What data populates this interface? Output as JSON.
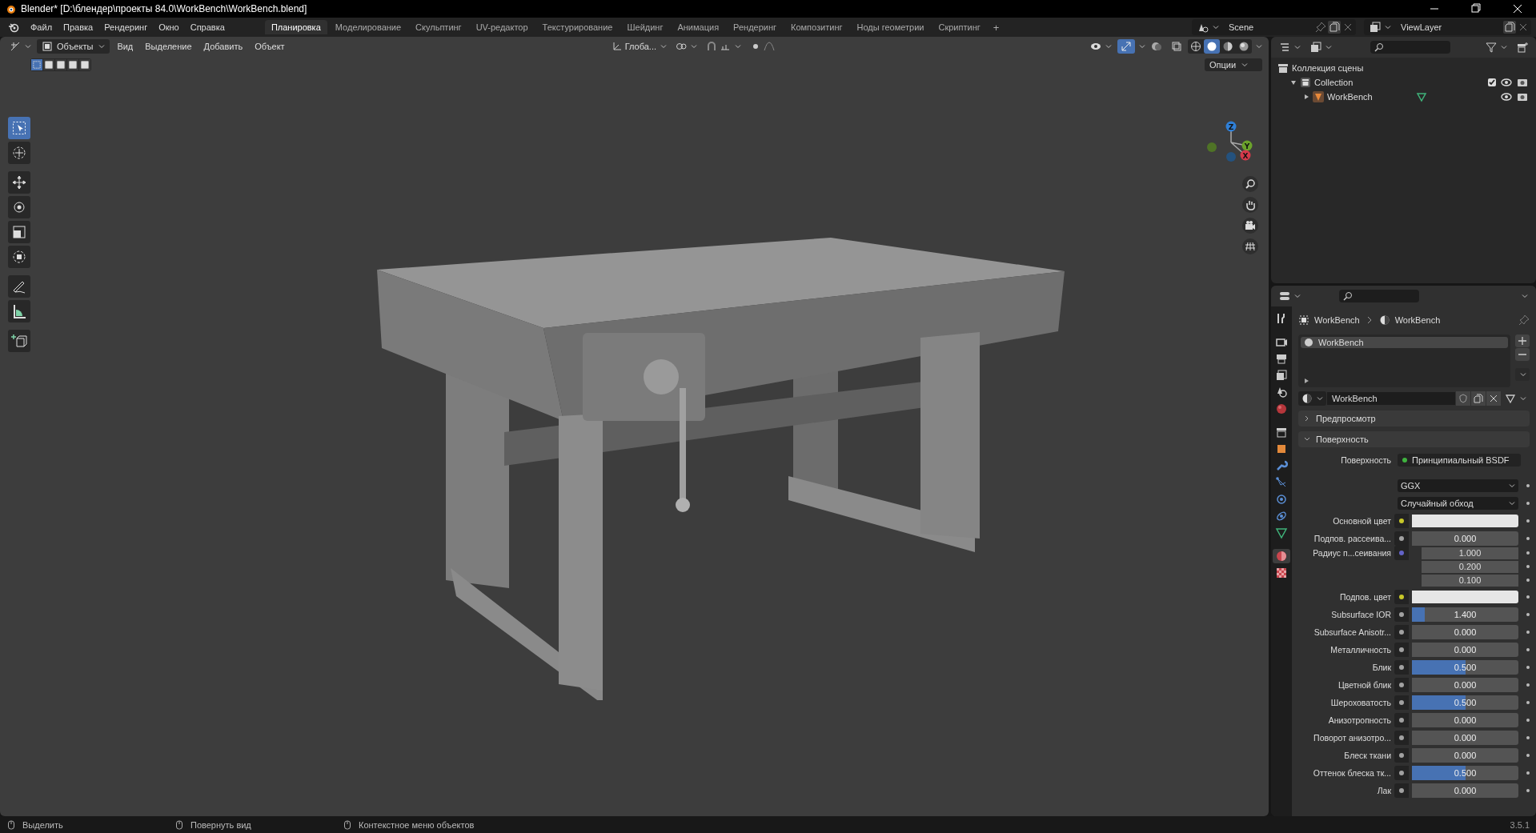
{
  "window": {
    "title": "Blender* [D:\\блендер\\проекты 84.0\\WorkBench\\WorkBench.blend]"
  },
  "menu": [
    "Файл",
    "Правка",
    "Рендеринг",
    "Окно",
    "Справка"
  ],
  "workspaces": [
    {
      "label": "Планировка",
      "selected": true
    },
    {
      "label": "Моделирование",
      "selected": false
    },
    {
      "label": "Скульптинг",
      "selected": false
    },
    {
      "label": "UV-редактор",
      "selected": false
    },
    {
      "label": "Текстурирование",
      "selected": false
    },
    {
      "label": "Шейдинг",
      "selected": false
    },
    {
      "label": "Анимация",
      "selected": false
    },
    {
      "label": "Рендеринг",
      "selected": false
    },
    {
      "label": "Композитинг",
      "selected": false
    },
    {
      "label": "Ноды геометрии",
      "selected": false
    },
    {
      "label": "Скриптинг",
      "selected": false
    }
  ],
  "add_workspace": "+",
  "scene": "Scene",
  "view_layer": "ViewLayer",
  "viewport": {
    "mode": "Объекты",
    "menus": [
      "Вид",
      "Выделение",
      "Добавить",
      "Объект"
    ],
    "orientation": "Глоба...",
    "options": "Опции",
    "select_modes": [
      {
        "selected": true
      },
      {
        "selected": false
      },
      {
        "selected": false
      },
      {
        "selected": false
      },
      {
        "selected": false
      }
    ],
    "gizmos_on": true,
    "shading_modes": [
      {
        "kind": "wireframe",
        "selected": false
      },
      {
        "kind": "solid",
        "selected": true
      },
      {
        "kind": "material",
        "selected": false
      },
      {
        "kind": "rendered",
        "selected": false
      }
    ],
    "tools": [
      {
        "kind": "select",
        "selected": true
      },
      {
        "kind": "cursor",
        "selected": false
      },
      {
        "kind": "move",
        "selected": false
      },
      {
        "kind": "rotate",
        "selected": false
      },
      {
        "kind": "scale",
        "selected": false
      },
      {
        "kind": "transform",
        "selected": false
      },
      {
        "kind": "annotate",
        "selected": false
      },
      {
        "kind": "measure",
        "selected": false
      },
      {
        "kind": "add_cube",
        "selected": false
      }
    ],
    "gizmo_axes": [
      "Z",
      "Y",
      "X"
    ],
    "scene_content": {
      "kind": "picture"
    }
  },
  "outliner": {
    "tree": [
      {
        "label": "Коллекция сцены",
        "kind": "scene_collection",
        "children": [
          {
            "label": "Collection",
            "kind": "collection",
            "expanded": true,
            "checked": true,
            "children": [
              {
                "label": "WorkBench",
                "kind": "object",
                "expanded": false
              }
            ]
          }
        ]
      }
    ]
  },
  "properties": {
    "tabs": [
      {
        "kind": "tool",
        "selected": false
      },
      {
        "kind": "render",
        "selected": false
      },
      {
        "kind": "output",
        "selected": false
      },
      {
        "kind": "view_layer",
        "selected": false
      },
      {
        "kind": "scene",
        "selected": false
      },
      {
        "kind": "world",
        "selected": false
      },
      {
        "kind": "collection",
        "selected": false
      },
      {
        "kind": "object",
        "selected": false
      },
      {
        "kind": "modifier",
        "selected": false
      },
      {
        "kind": "particles",
        "selected": false
      },
      {
        "kind": "physics",
        "selected": false
      },
      {
        "kind": "constraints",
        "selected": false
      },
      {
        "kind": "data",
        "selected": false
      },
      {
        "kind": "material",
        "selected": true
      },
      {
        "kind": "texture",
        "selected": false
      }
    ],
    "breadcrumb": [
      "WorkBench",
      "WorkBench"
    ],
    "slots": [
      {
        "label": "WorkBench",
        "selected": true
      }
    ],
    "material": "WorkBench",
    "panels": [
      {
        "label": "Предпросмотр",
        "expanded": false
      },
      {
        "label": "Поверхность",
        "expanded": true
      }
    ],
    "surface_label": "Поверхность",
    "surface": "Принципиальный BSDF",
    "dropdowns": [
      "GGX",
      "Случайный обход"
    ],
    "fields": [
      {
        "label": "Основной цвет",
        "kind": "color",
        "color": "#e6e6e6"
      },
      {
        "label": "Подпов. рассеива...",
        "kind": "value",
        "value": "0.000"
      },
      {
        "label": "Радиус п...сеивания",
        "kind": "vector",
        "values": [
          "1.000",
          "0.200",
          "0.100"
        ]
      },
      {
        "label": "Подпов. цвет",
        "kind": "color",
        "color": "#e6e6e6"
      },
      {
        "label": "Subsurface IOR",
        "kind": "value",
        "value": "1.400",
        "level": 0.12
      },
      {
        "label": "Subsurface Anisotr...",
        "kind": "value",
        "value": "0.000"
      },
      {
        "label": "Металличность",
        "kind": "value",
        "value": "0.000"
      },
      {
        "label": "Блик",
        "kind": "value",
        "value": "0.500",
        "level": 0.5
      },
      {
        "label": "Цветной блик",
        "kind": "value",
        "value": "0.000"
      },
      {
        "label": "Шероховатость",
        "kind": "value",
        "value": "0.500",
        "level": 0.5
      },
      {
        "label": "Анизотропность",
        "kind": "value",
        "value": "0.000"
      },
      {
        "label": "Поворот анизотро...",
        "kind": "value",
        "value": "0.000"
      },
      {
        "label": "Блеск ткани",
        "kind": "value",
        "value": "0.000"
      },
      {
        "label": "Оттенок блеска тк...",
        "kind": "value",
        "value": "0.500",
        "level": 0.5
      },
      {
        "label": "Лак",
        "kind": "value",
        "value": "0.000"
      }
    ]
  },
  "status_bar": {
    "hints": [
      "Выделить",
      "Повернуть вид",
      "Контекстное меню объектов"
    ],
    "version": "3.5.1"
  }
}
